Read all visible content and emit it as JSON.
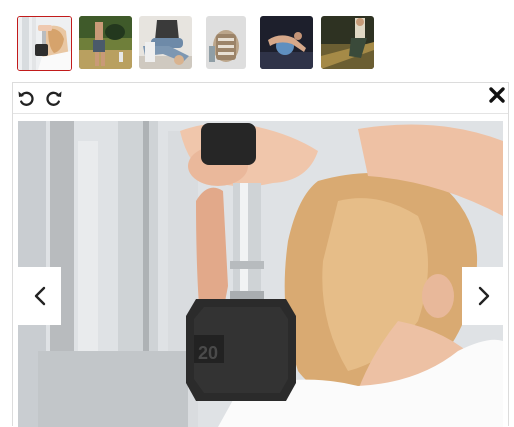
{
  "gallery": {
    "thumbnails": [
      {
        "icon": "woman-dumbbell-thumbnail",
        "selected": true
      },
      {
        "icon": "woman-outdoor-exercise-thumbnail",
        "selected": false
      },
      {
        "icon": "seated-stretch-thumbnail",
        "selected": false
      },
      {
        "icon": "gym-bag-thumbnail",
        "selected": false
      },
      {
        "icon": "exercise-ball-thumbnail",
        "selected": false
      },
      {
        "icon": "woman-stretching-outdoor-thumbnail",
        "selected": false
      }
    ]
  },
  "viewer": {
    "toolbar": {
      "icons": [
        "rotate-left-icon",
        "rotate-right-icon",
        "close-icon"
      ]
    },
    "image": {
      "icon": "woman-lifting-dumbbell-photo",
      "dumbbell_text": "20"
    },
    "navigation": {
      "icons": [
        "chevron-left-icon",
        "chevron-right-icon"
      ]
    }
  },
  "colors": {
    "selected_border": "#c21b1b",
    "nav_background": "#ffffff"
  }
}
